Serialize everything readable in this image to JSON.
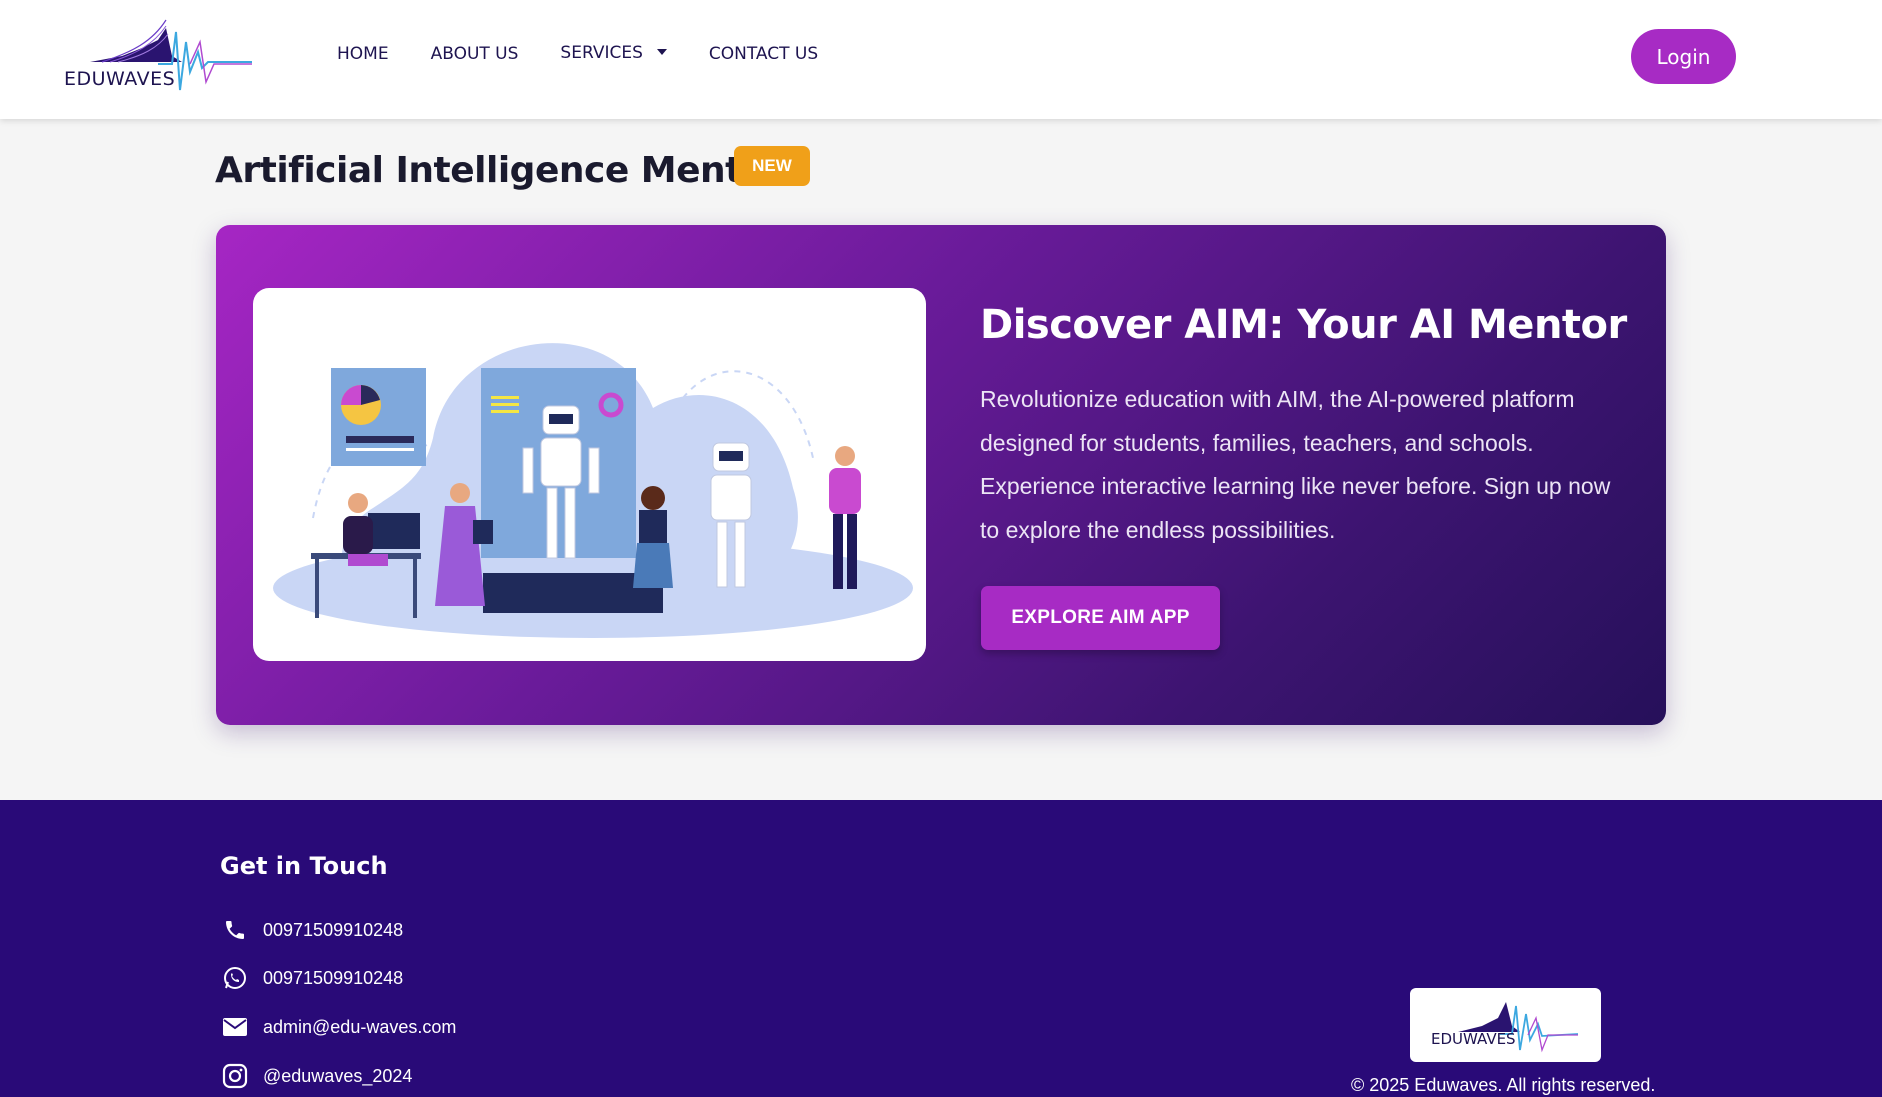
{
  "header": {
    "logo_text": "EDUWAVES",
    "nav": [
      "HOME",
      "ABOUT US",
      "SERVICES",
      "CONTACT US"
    ],
    "login_label": "Login"
  },
  "section": {
    "title": "Artificial Intelligence Mentor",
    "badge": "NEW"
  },
  "hero": {
    "heading": "Discover AIM: Your AI Mentor",
    "text": "Revolutionize education with AIM, the AI-powered platform designed for students, families, teachers, and schools. Experience interactive learning like never before. Sign up now to explore the endless possibilities.",
    "button_label": "EXPLORE AIM APP"
  },
  "footer": {
    "title": "Get in Touch",
    "contacts": [
      {
        "icon": "phone-icon",
        "value": "00971509910248"
      },
      {
        "icon": "whatsapp-icon",
        "value": "00971509910248"
      },
      {
        "icon": "email-icon",
        "value": "admin@edu-waves.com"
      },
      {
        "icon": "instagram-icon",
        "value": "@eduwaves_2024"
      }
    ],
    "logo_text": "EDUWAVES",
    "copyright": "© 2025 Eduwaves. All rights reserved."
  },
  "colors": {
    "brand_purple": "#a72bc4",
    "footer_bg": "#290a78",
    "badge_orange": "#f0a019",
    "nav_text": "#1e1450"
  }
}
